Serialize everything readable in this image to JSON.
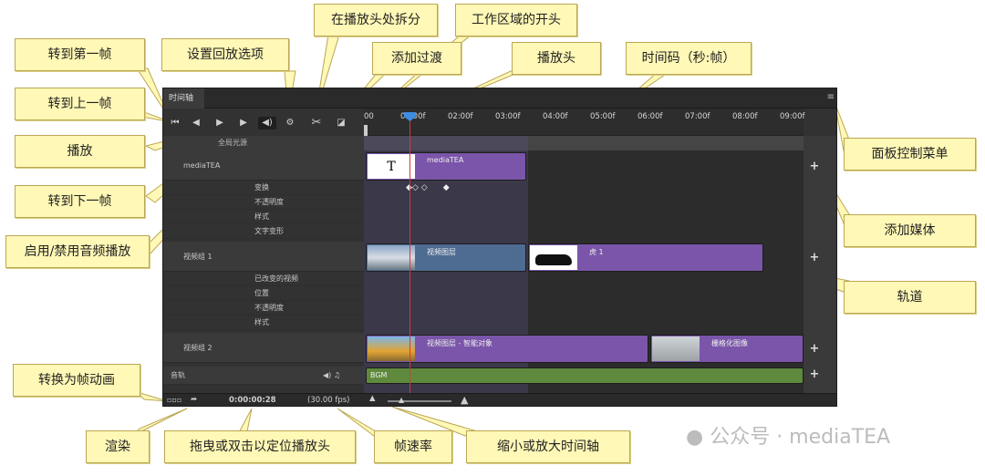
{
  "panel": {
    "tab": "时间轴",
    "menu_icon": "≡",
    "controls": {
      "first": "⏮",
      "prev": "◀",
      "play": "▶",
      "next": "▶",
      "audio": "◀)",
      "settings": "⚙",
      "split": "✂",
      "transition": "◪"
    },
    "ruler": [
      "00",
      "01:00f",
      "02:00f",
      "03:00f",
      "04:00f",
      "05:00f",
      "06:00f",
      "07:00f",
      "08:00f",
      "09:00f"
    ],
    "all_sources": "全局光源",
    "tracks": {
      "group1": {
        "name": "mediaTEA",
        "props": [
          "变换",
          "不透明度",
          "样式",
          "文字变形"
        ],
        "clip_label": "mediaTEA",
        "text_thumb": "T"
      },
      "group2": {
        "name": "视频组 1",
        "props": [
          "已改变的视频",
          "位置",
          "不透明度",
          "样式"
        ],
        "clip1": "视频图层",
        "clip2": "虎 1"
      },
      "group3": {
        "name": "视频组 2",
        "clip1": "视频图层 - 智能对象",
        "clip2": "栅格化图像"
      },
      "audio": {
        "name": "音轨",
        "clip": "BGM"
      }
    },
    "bottom": {
      "timecode": "0:00:00:28",
      "fps": "(30.00 fps)"
    }
  },
  "annotations": {
    "first_frame": "转到第一帧",
    "prev_frame": "转到上一帧",
    "play": "播放",
    "next_frame": "转到下一帧",
    "audio_toggle": "启用/禁用音频播放",
    "playback_options": "设置回放选项",
    "split_at_playhead": "在播放头处拆分",
    "work_area_start": "工作区域的开头",
    "add_transition": "添加过渡",
    "playhead": "播放头",
    "timecode": "时间码（秒:帧）",
    "panel_menu": "面板控制菜单",
    "add_media": "添加媒体",
    "track": "轨道",
    "convert_frame_anim": "转换为帧动画",
    "render": "渲染",
    "drag_timecode": "拖曳或双击以定位播放头",
    "framerate": "帧速率",
    "zoom": "缩小或放大时间轴"
  },
  "watermark": "公众号 · mediaTEA",
  "colors": {
    "label_bg": "#fff8b6",
    "purple_clip": "#7a55a9",
    "blue_clip": "#4e6c92",
    "audio_clip": "#5f8a3d",
    "playhead": "#d23b3b"
  }
}
